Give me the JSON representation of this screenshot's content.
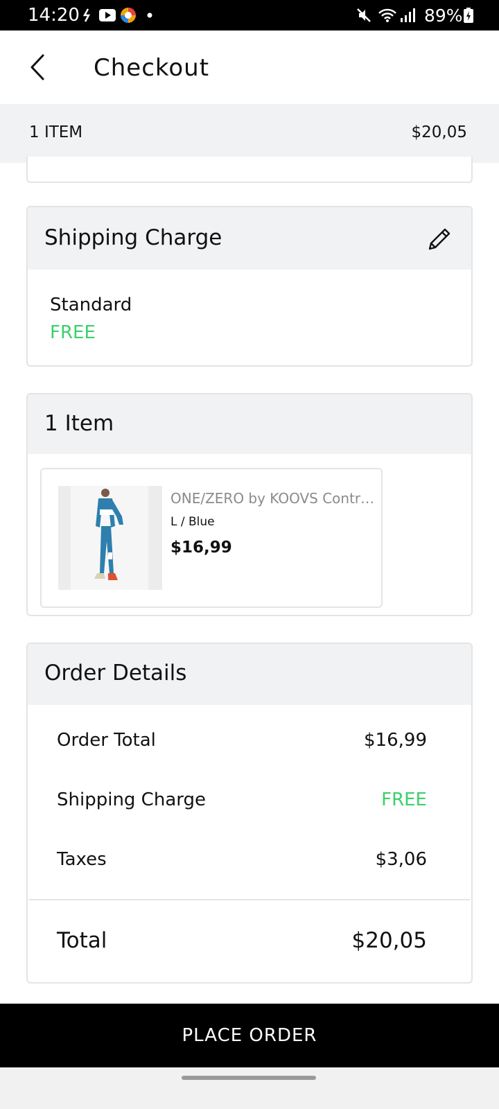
{
  "status_bar": {
    "time": "14:20",
    "battery": "89%",
    "icons": [
      "missed-call-icon",
      "youtube-icon",
      "app-icon",
      "dot-icon",
      "mute-icon",
      "wifi-icon",
      "signal-icon",
      "battery-charging-icon"
    ]
  },
  "header": {
    "back_icon": "back-arrow-icon",
    "title": "Checkout"
  },
  "summary": {
    "count": "1 ITEM",
    "total": "$20,05"
  },
  "shipping": {
    "title": "Shipping Charge",
    "edit_icon": "pencil-icon",
    "method": "Standard",
    "price": "FREE"
  },
  "items": {
    "title": "1 Item",
    "products": [
      {
        "name": "ONE/ZERO by KOOVS Contra...",
        "variant": "L / Blue",
        "price": "$16,99"
      }
    ]
  },
  "order_details": {
    "title": "Order Details",
    "rows": [
      {
        "label": "Order Total",
        "value": "$16,99"
      },
      {
        "label": "Shipping Charge",
        "value": "FREE"
      },
      {
        "label": "Taxes",
        "value": "$3,06"
      }
    ],
    "total_label": "Total",
    "total_value": "$20,05"
  },
  "actions": {
    "place_order": "PLACE ORDER"
  },
  "colors": {
    "accent_green": "#3ccf6b",
    "panel_gray": "#f1f2f4",
    "button_black": "#000000"
  }
}
